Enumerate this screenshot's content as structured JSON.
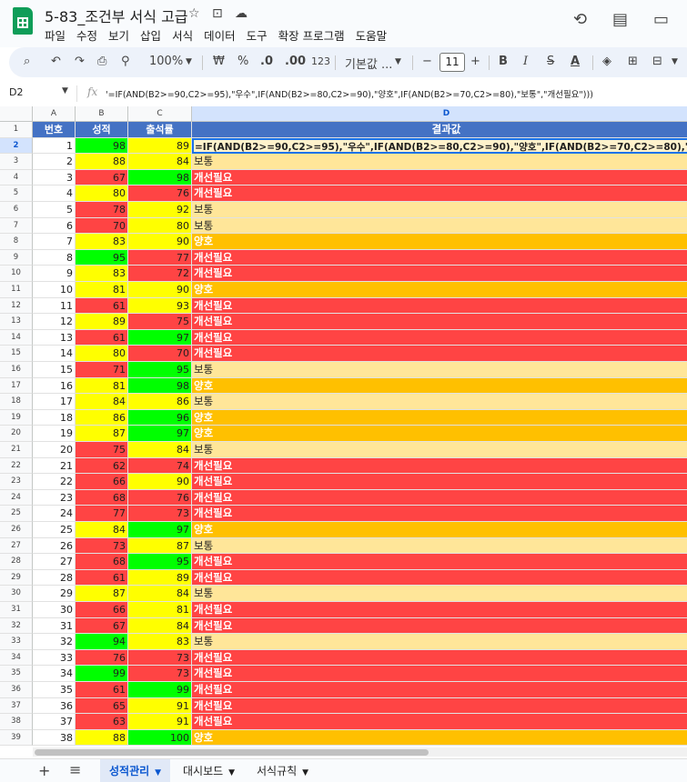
{
  "document": {
    "title": "5-83_조건부 서식 고급"
  },
  "menu": [
    "파일",
    "수정",
    "보기",
    "삽입",
    "서식",
    "데이터",
    "도구",
    "확장 프로그램",
    "도움말"
  ],
  "toolbar": {
    "zoom": "100%",
    "currency": "₩",
    "percent": "%",
    "dec_decrease": ".0",
    "dec_increase": ".00",
    "number_format": "123",
    "font": "기본값 ...",
    "font_size": "11",
    "minus": "−",
    "plus": "+",
    "bold": "B",
    "italic": "I",
    "strike": "S",
    "text_color": "A"
  },
  "formula_bar": {
    "cell_ref": "D2",
    "fx": "fx",
    "formula": "'=IF(AND(B2>=90,C2>=95),\"우수\",IF(AND(B2>=80,C2>=90),\"양호\",IF(AND(B2>=70,C2>=80),\"보통\",\"개선필요\")))"
  },
  "columns": [
    "A",
    "B",
    "C",
    "D"
  ],
  "header_row": [
    "번호",
    "성적",
    "출석률",
    "결과값"
  ],
  "formula_cell": "=IF(AND(B2>=90,C2>=95),\"우수\",IF(AND(B2>=80,C2>=90),\"양호\",IF(AND(B2>=70,C2>=80),\"보통\",\"개선필요\")))",
  "rows": [
    {
      "n": "1",
      "score": "98",
      "att": "89",
      "result": ""
    },
    {
      "n": "2",
      "score": "88",
      "att": "84",
      "result": "보통"
    },
    {
      "n": "3",
      "score": "67",
      "att": "98",
      "result": "개선필요"
    },
    {
      "n": "4",
      "score": "80",
      "att": "76",
      "result": "개선필요"
    },
    {
      "n": "5",
      "score": "78",
      "att": "92",
      "result": "보통"
    },
    {
      "n": "6",
      "score": "70",
      "att": "80",
      "result": "보통"
    },
    {
      "n": "7",
      "score": "83",
      "att": "90",
      "result": "양호"
    },
    {
      "n": "8",
      "score": "95",
      "att": "77",
      "result": "개선필요"
    },
    {
      "n": "9",
      "score": "83",
      "att": "72",
      "result": "개선필요"
    },
    {
      "n": "10",
      "score": "81",
      "att": "90",
      "result": "양호"
    },
    {
      "n": "11",
      "score": "61",
      "att": "93",
      "result": "개선필요"
    },
    {
      "n": "12",
      "score": "89",
      "att": "75",
      "result": "개선필요"
    },
    {
      "n": "13",
      "score": "61",
      "att": "97",
      "result": "개선필요"
    },
    {
      "n": "14",
      "score": "80",
      "att": "70",
      "result": "개선필요"
    },
    {
      "n": "15",
      "score": "71",
      "att": "95",
      "result": "보통"
    },
    {
      "n": "16",
      "score": "81",
      "att": "98",
      "result": "양호"
    },
    {
      "n": "17",
      "score": "84",
      "att": "86",
      "result": "보통"
    },
    {
      "n": "18",
      "score": "86",
      "att": "96",
      "result": "양호"
    },
    {
      "n": "19",
      "score": "87",
      "att": "97",
      "result": "양호"
    },
    {
      "n": "20",
      "score": "75",
      "att": "84",
      "result": "보통"
    },
    {
      "n": "21",
      "score": "62",
      "att": "74",
      "result": "개선필요"
    },
    {
      "n": "22",
      "score": "66",
      "att": "90",
      "result": "개선필요"
    },
    {
      "n": "23",
      "score": "68",
      "att": "76",
      "result": "개선필요"
    },
    {
      "n": "24",
      "score": "77",
      "att": "73",
      "result": "개선필요"
    },
    {
      "n": "25",
      "score": "84",
      "att": "97",
      "result": "양호"
    },
    {
      "n": "26",
      "score": "73",
      "att": "87",
      "result": "보통"
    },
    {
      "n": "27",
      "score": "68",
      "att": "95",
      "result": "개선필요"
    },
    {
      "n": "28",
      "score": "61",
      "att": "89",
      "result": "개선필요"
    },
    {
      "n": "29",
      "score": "87",
      "att": "84",
      "result": "보통"
    },
    {
      "n": "30",
      "score": "66",
      "att": "81",
      "result": "개선필요"
    },
    {
      "n": "31",
      "score": "67",
      "att": "84",
      "result": "개선필요"
    },
    {
      "n": "32",
      "score": "94",
      "att": "83",
      "result": "보통"
    },
    {
      "n": "33",
      "score": "76",
      "att": "73",
      "result": "개선필요"
    },
    {
      "n": "34",
      "score": "99",
      "att": "73",
      "result": "개선필요"
    },
    {
      "n": "35",
      "score": "61",
      "att": "99",
      "result": "개선필요"
    },
    {
      "n": "36",
      "score": "65",
      "att": "91",
      "result": "개선필요"
    },
    {
      "n": "37",
      "score": "63",
      "att": "91",
      "result": "개선필요"
    },
    {
      "n": "38",
      "score": "88",
      "att": "100",
      "result": "양호"
    }
  ],
  "colors": {
    "header": "#4472c4",
    "green": "#00ff00",
    "yellow": "#ffff00",
    "red": "#ff4444",
    "good": "#ffc000",
    "normal": "#ffe699"
  },
  "sheets": [
    {
      "name": "성적관리",
      "active": true
    },
    {
      "name": "대시보드",
      "active": false
    },
    {
      "name": "서식규칙",
      "active": false
    }
  ]
}
